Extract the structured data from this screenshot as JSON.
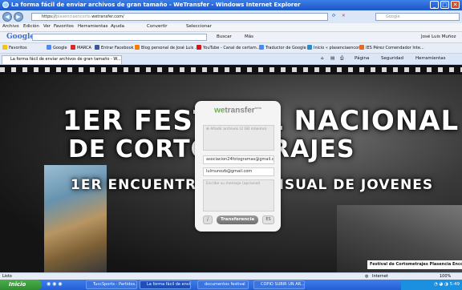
{
  "window": {
    "title": "La forma fácil de enviar archivos de gran tamaño - WeTransfer - Windows Internet Explorer",
    "controls": [
      "_",
      "□",
      "✕"
    ]
  },
  "address_bar": {
    "url_prefix": "https://",
    "url_gray": "plasenciaencorto.",
    "url_host": "wetransfer.com/",
    "search_placeholder": "Google"
  },
  "menu": {
    "items": [
      "Archivo",
      "Edición",
      "Ver",
      "Favoritos",
      "Herramientas",
      "Ayuda"
    ],
    "convert": "Convertir",
    "select": "Seleccionar"
  },
  "google_toolbar": {
    "logo": "Google",
    "buscar": "Buscar",
    "mas": "Más",
    "user": "José Luis Muñoz"
  },
  "favorites": {
    "label": "Favoritos",
    "items": [
      "Google",
      "MARCA",
      "Entrar Facebook",
      "Blog personal de José Luis ...",
      "YouTube - Canal de certam...",
      "Traductor de Google",
      "Inicio « plasenciaencorto",
      "IES Pérez Comendador Inte..."
    ]
  },
  "tab": {
    "label": "La forma fácil de enviar archivos de gran tamaño - W..."
  },
  "command_bar": {
    "pagina": "Página",
    "seguridad": "Seguridad",
    "herramientas": "Herramientas"
  },
  "page": {
    "line1": "1ER FESTIVAL NACIONAL",
    "line2": "DE CORTOMETRAJES",
    "line3": "1ER ENCUENTRO AUDIOVISUAL DE JOVENES",
    "caption": "Festival de Cortometrajes Plasencia Encorto"
  },
  "transfer_panel": {
    "logo_we": "we",
    "logo_rest": "transfer",
    "logo_beta": "beta",
    "add_files": "Añadir archivos (2 GB máximo)",
    "to_email": "asociacion24fotogramas@gmail.com",
    "from_email": "lulmunozb@gmail.com",
    "message_placeholder": "Escribe su mensaje (opcional)",
    "info": "i",
    "send": "Transferencia",
    "lang": "ES"
  },
  "status_bar": {
    "left": "Listo",
    "zone": "Internet",
    "zoom": "100%"
  },
  "taskbar": {
    "start": "Inicio",
    "tasks": [
      "TuccSports - Partidos...",
      "La forma fácil de envi...",
      "documentos festival",
      "COPIO SUBIR UN AR..."
    ],
    "clock": "5:49"
  },
  "colors": {
    "titlebar": "#1c55c9",
    "panel_bg": "#f4f4f4",
    "we_green": "#6ab04c",
    "start_green": "#2f8d2f"
  }
}
